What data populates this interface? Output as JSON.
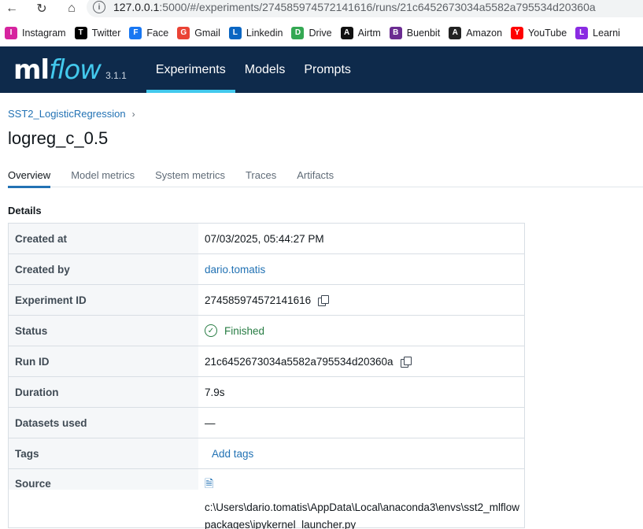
{
  "browser": {
    "url_host": "127.0.0.1",
    "url_rest": ":5000/#/experiments/274585974572141616/runs/21c6452673034a5582a795534d20360a",
    "bookmarks": [
      {
        "label": "Instagram",
        "icon": "instagram-icon",
        "color": "#d6249f"
      },
      {
        "label": "Twitter",
        "icon": "x-icon",
        "color": "#000000"
      },
      {
        "label": "Face",
        "icon": "facebook-icon",
        "color": "#1877f2"
      },
      {
        "label": "Gmail",
        "icon": "gmail-icon",
        "color": "#ea4335"
      },
      {
        "label": "Linkedin",
        "icon": "linkedin-icon",
        "color": "#0a66c2"
      },
      {
        "label": "Drive",
        "icon": "drive-icon",
        "color": "#34a853"
      },
      {
        "label": "Airtm",
        "icon": "airtm-icon",
        "color": "#111111"
      },
      {
        "label": "Buenbit",
        "icon": "buenbit-icon",
        "color": "#6b2c91"
      },
      {
        "label": "Amazon",
        "icon": "amazon-icon",
        "color": "#222222"
      },
      {
        "label": "YouTube",
        "icon": "youtube-icon",
        "color": "#ff0000"
      },
      {
        "label": "Learni",
        "icon": "learning-icon",
        "color": "#8a2be2"
      }
    ]
  },
  "header": {
    "logo_ml": "ml",
    "logo_flow": "flow",
    "version": "3.1.1",
    "nav": [
      {
        "label": "Experiments",
        "active": true
      },
      {
        "label": "Models",
        "active": false
      },
      {
        "label": "Prompts",
        "active": false
      }
    ],
    "accent": "#43c9ed",
    "background": "#0e2a4b"
  },
  "breadcrumb": {
    "experiment": "SST2_LogisticRegression",
    "separator": "›"
  },
  "run": {
    "title": "logreg_c_0.5"
  },
  "tabs": [
    {
      "label": "Overview",
      "active": true
    },
    {
      "label": "Model metrics",
      "active": false
    },
    {
      "label": "System metrics",
      "active": false
    },
    {
      "label": "Traces",
      "active": false
    },
    {
      "label": "Artifacts",
      "active": false
    }
  ],
  "details": {
    "heading": "Details",
    "rows": {
      "created_at": {
        "key": "Created at",
        "value": "07/03/2025, 05:44:27 PM"
      },
      "created_by": {
        "key": "Created by",
        "value": "dario.tomatis"
      },
      "experiment_id": {
        "key": "Experiment ID",
        "value": "274585974572141616"
      },
      "status": {
        "key": "Status",
        "value": "Finished"
      },
      "run_id": {
        "key": "Run ID",
        "value": "21c6452673034a5582a795534d20360a"
      },
      "duration": {
        "key": "Duration",
        "value": "7.9s"
      },
      "datasets": {
        "key": "Datasets used",
        "value": "—"
      },
      "tags": {
        "key": "Tags",
        "value": "Add tags"
      },
      "source": {
        "key": "Source",
        "line1": "c:\\Users\\dario.tomatis\\AppData\\Local\\anaconda3\\envs\\sst2_mlflow",
        "line2": "packages\\ipykernel_launcher.py"
      }
    }
  }
}
